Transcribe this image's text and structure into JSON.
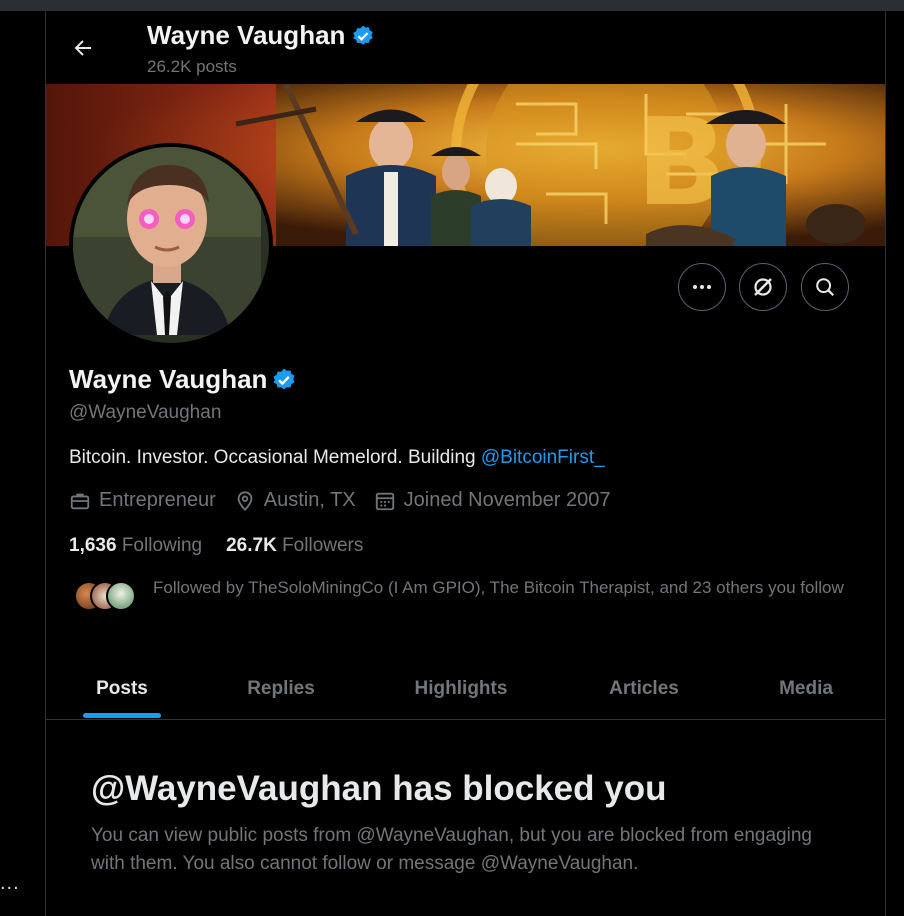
{
  "header": {
    "name": "Wayne Vaughan",
    "posts_count": "26.2K posts"
  },
  "profile": {
    "name": "Wayne Vaughan",
    "handle": "@WayneVaughan",
    "bio_text": "Bitcoin. Investor. Occasional Memelord. Building ",
    "bio_mention": "@BitcoinFirst_",
    "occupation": "Entrepreneur",
    "location": "Austin, TX",
    "joined": "Joined November 2007",
    "following_count": "1,636",
    "following_label": "Following",
    "followers_count": "26.7K",
    "followers_label": "Followers",
    "followed_by": "Followed by TheSoloMiningCo (I Am GPIO), The Bitcoin Therapist, and 23 others you follow",
    "verified_color": "#1d9bf0"
  },
  "actions": {
    "more_icon": "more-icon",
    "grok_icon": "grok-icon",
    "search_icon": "search-icon"
  },
  "tabs": [
    {
      "label": "Posts",
      "active": true
    },
    {
      "label": "Replies",
      "active": false
    },
    {
      "label": "Highlights",
      "active": false
    },
    {
      "label": "Articles",
      "active": false
    },
    {
      "label": "Media",
      "active": false
    }
  ],
  "blocked": {
    "title": "@WayneVaughan has blocked you",
    "message": "You can view public posts from @WayneVaughan, but you are blocked from engaging with them. You also cannot follow or message @WayneVaughan."
  },
  "sidebar": {
    "overflow": "..."
  },
  "colors": {
    "accent": "#1d9bf0",
    "background": "#000000",
    "secondary_text": "#71767b"
  }
}
